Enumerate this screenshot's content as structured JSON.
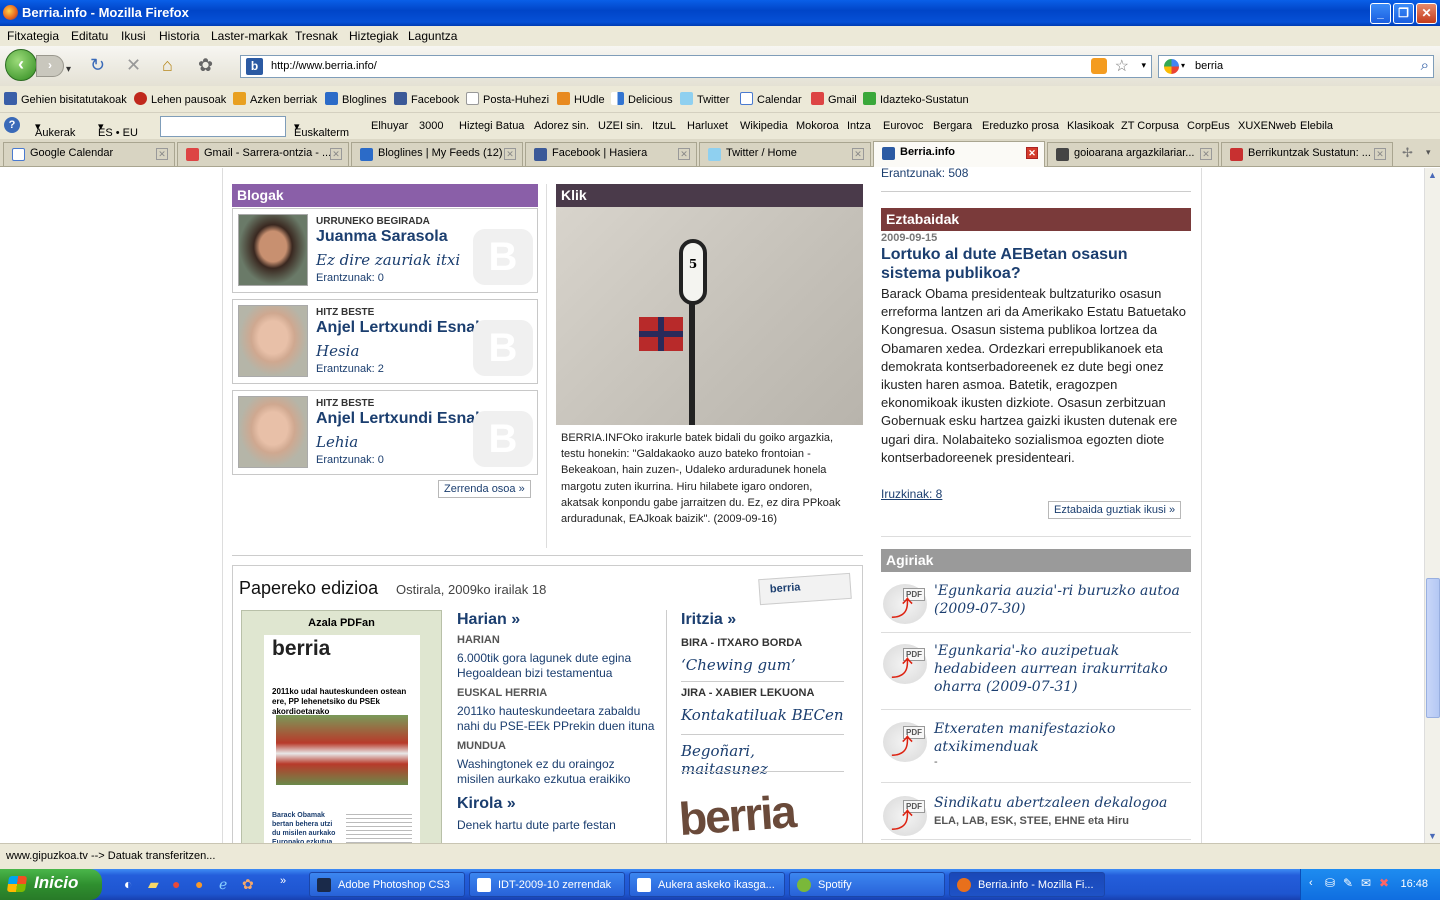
{
  "window": {
    "title": "Berria.info - Mozilla Firefox"
  },
  "menu": [
    "Fitxategia",
    "Editatu",
    "Ikusi",
    "Historia",
    "Laster-markak",
    "Tresnak",
    "Hiztegiak",
    "Laguntza"
  ],
  "nav": {
    "url": "http://www.berria.info/",
    "search": "berria"
  },
  "bookmarks": [
    "Gehien bisitatutakoak",
    "Lehen pausoak",
    "Azken berriak",
    "Bloglines",
    "Facebook",
    "Posta-Huhezi",
    "HUdle",
    "Delicious",
    "Twitter",
    "Calendar",
    "Gmail",
    "Idazteko-Sustatun"
  ],
  "toolbar2": {
    "aukerak": "Aukerak",
    "lang": "ES • EU",
    "items": [
      "Euskalterm",
      "Elhuyar",
      "3000",
      "Hiztegi Batua",
      "Adorez sin.",
      "UZEI sin.",
      "ItzuL",
      "Harluxet",
      "Wikipedia",
      "Mokoroa",
      "Intza",
      "Eurovoc",
      "Bergara",
      "Ereduzko prosa",
      "Klasikoak",
      "ZT Corpusa",
      "CorpEus",
      "XUXENweb",
      "Elebila"
    ]
  },
  "tabs": [
    "Google Calendar",
    "Gmail - Sarrera-ontzia - ...",
    "Bloglines | My Feeds (12)",
    "Facebook | Hasiera",
    "Twitter / Home",
    "Berria.info",
    "goioarana argazkilariar...",
    "Berrikuntzak Sustatun: ..."
  ],
  "blogs": {
    "header": "Blogak",
    "items": [
      {
        "kicker": "URRUNEKO BEGIRADA",
        "name": "Juanma Sarasola",
        "title": "Ez dire zauriak itxi",
        "count": "Erantzunak: 0"
      },
      {
        "kicker": "HITZ BESTE",
        "name": "Anjel Lertxundi Esnal",
        "title": "Hesia",
        "count": "Erantzunak: 2"
      },
      {
        "kicker": "HITZ BESTE",
        "name": "Anjel Lertxundi Esnal",
        "title": "Lehia",
        "count": "Erantzunak: 0"
      }
    ],
    "more": "Zerrenda osoa »"
  },
  "klik": {
    "header": "Klik",
    "sign_number": "5",
    "caption": "BERRIA.INFOko irakurle batek bidali du goiko argazkia, testu honekin: \"Galdakaoko auzo bateko frontoian -Bekeakoan, hain zuzen-, Udaleko arduradunek honela margotu zuten ikurrina. Hiru hilabete igaro ondoren, akatsak konpondu gabe jarraitzen du. Ez, ez dira PPkoak arduradunak, EAJkoak baizik\". (2009-09-16)"
  },
  "right": {
    "top_count": "Erantzunak: 508",
    "eztabaidak": {
      "header": "Eztabaidak",
      "date": "2009-09-15",
      "title": "Lortuko al dute AEBetan osasun sistema publikoa?",
      "body": "Barack Obama presidenteak bultzaturiko osasun erreforma lantzen ari da Amerikako Estatu Batuetako Kongresua. Osasun sistema publikoa lortzea da Obamaren xedea. Ordezkari errepublikanoek eta demokrata kontserbadoreenek ez dute begi onez ikusten haren asmoa. Batetik, eragozpen ekonomikoak ikusten dizkiote. Osasun zerbitzuan Gobernuak esku hartzea gaizki ikusten dutenak ere ugari dira. Nolabaiteko sozialismoa egozten diote kontserbadoreenek presidenteari.",
      "comments": "Iruzkinak: 8",
      "more": "Eztabaida guztiak ikusi »"
    },
    "agiriak": {
      "header": "Agiriak",
      "pdf_label": "PDF",
      "items": [
        {
          "title": "'Egunkaria auzia'-ri buruzko autoa (2009-07-30)",
          "sub": ""
        },
        {
          "title": "'Egunkaria'-ko auzipetuak hedabideen aurrean irakurritako oharra (2009-07-31)",
          "sub": ""
        },
        {
          "title": "Etxeraten manifestazioko atxikimenduak",
          "sub": "-"
        },
        {
          "title": "Sindikatu abertzaleen dekalogoa",
          "sub": "ELA, LAB, ESK, STEE, EHNE eta Hiru"
        }
      ]
    }
  },
  "paper": {
    "title": "Papereko edizioa",
    "date": "Ostirala, 2009ko irailak 18",
    "logo": "berria",
    "cover_label": "Azala PDFan",
    "cover_masthead": "berria",
    "cover_headline": "2011ko udal hauteskundeen ostean ere, PP lehenetsiko du PSEk akordioetarako",
    "cover_lede": "Barack Obamak bertan behera utzi du misilen aurkako Europako ezkutua",
    "harian": {
      "header": "Harian »",
      "sections": [
        {
          "kicker": "HARIAN",
          "text": "6.000tik gora lagunek dute egina Hegoaldean bizi testamentua"
        },
        {
          "kicker": "EUSKAL HERRIA",
          "text": "2011ko hauteskundeetara zabaldu nahi du PSE-EEk PPrekin duen ituna"
        },
        {
          "kicker": "MUNDUA",
          "text": "Washingtonek ez du oraingoz misilen aurkako ezkutua eraikiko"
        }
      ]
    },
    "kirola": {
      "header": "Kirola »",
      "text": "Denek hartu dute parte festan"
    },
    "iritzia": {
      "header": "Iritzia »",
      "items": [
        {
          "kicker": "BIRA - ITXARO BORDA",
          "title": "‘Chewing gum’"
        },
        {
          "kicker": "JIRA - XABIER LEKUONA",
          "title": "Kontakatiluak BECen"
        },
        {
          "kicker": "",
          "title": "Begoñari, maitasunez"
        }
      ]
    },
    "promo": "berria"
  },
  "status": "www.gipuzkoa.tv --> Datuak transferitzen...",
  "taskbar": {
    "start": "Inicio",
    "tasks": [
      "Adobe Photoshop CS3",
      "IDT-2009-10 zerrendak",
      "Aukera askeko ikasga...",
      "Spotify",
      "Berria.info - Mozilla Fi..."
    ],
    "clock": "16:48"
  }
}
